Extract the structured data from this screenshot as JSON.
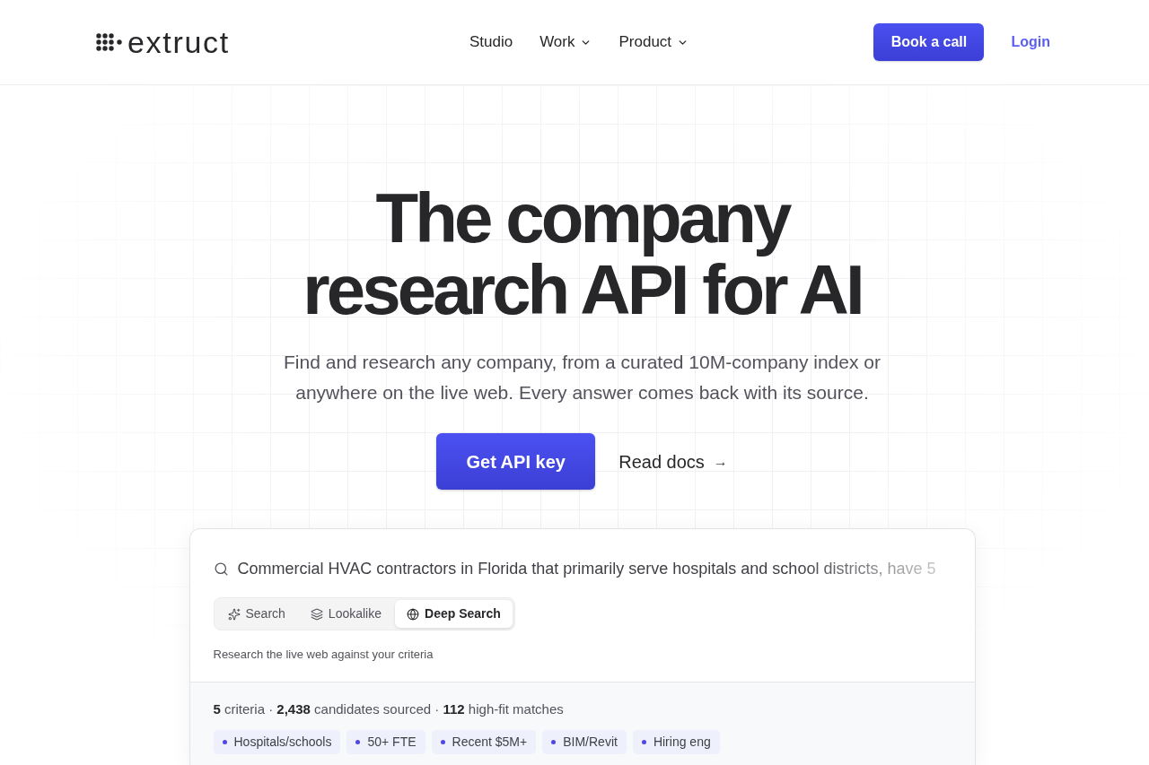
{
  "header": {
    "logo": "extruct",
    "nav": [
      {
        "label": "Studio",
        "has_menu": false
      },
      {
        "label": "Work",
        "has_menu": true
      },
      {
        "label": "Product",
        "has_menu": true
      }
    ],
    "book_button": "Book a call",
    "login": "Login"
  },
  "hero": {
    "title_lines": [
      "The company",
      "research API for AI"
    ],
    "subtitle": "Find and research any company, from a curated 10M-company index or anywhere on the live web. Every answer comes back with its source.",
    "primary_button": "Get API key",
    "secondary_link": "Read docs",
    "secondary_arrow": "→"
  },
  "demo": {
    "query": "Commercial HVAC contractors in Florida that primarily serve hospitals and school districts, have 5",
    "modes": [
      {
        "label": "Search",
        "selected": false
      },
      {
        "label": "Lookalike",
        "selected": false
      },
      {
        "label": "Deep Search",
        "selected": true
      }
    ],
    "mode_description": "Research the live web against your criteria",
    "summary": "**5** criteria · **2,438** candidates sourced · **112** high-fit matches",
    "criteria": [
      "Hospitals/schools",
      "50+ FTE",
      "Recent $5M+",
      "BIM/Revit",
      "Hiring eng"
    ]
  }
}
